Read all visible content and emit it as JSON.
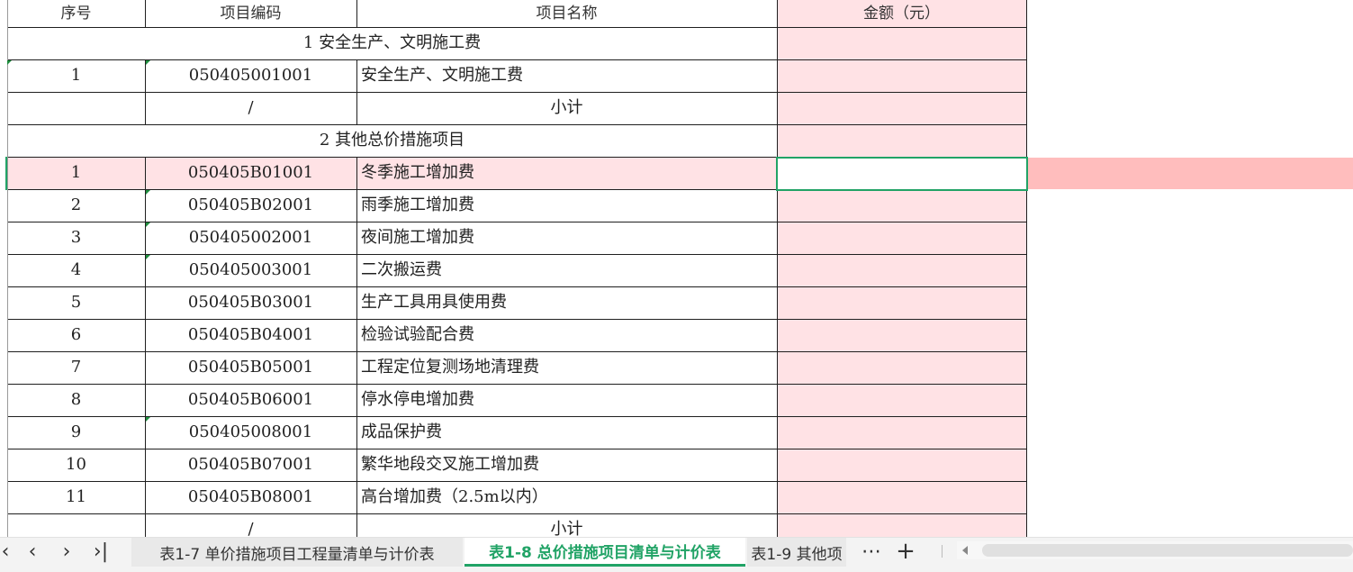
{
  "colors": {
    "amount_fill": "#ffe2e5",
    "row_highlight": "#ffe2e5",
    "row_band": "#ffbdbd",
    "selection_border": "#21a366",
    "active_tab_text": "#21a366"
  },
  "table": {
    "headers": [
      "序号",
      "项目编码",
      "项目名称",
      "金额（元）"
    ],
    "section1_title": "1 安全生产、文明施工费",
    "section1_rows": [
      {
        "no": "1",
        "code": "050405001001",
        "name": "安全生产、文明施工费"
      }
    ],
    "subtotal1": {
      "code": "/",
      "name": "小计"
    },
    "section2_title": "2 其他总价措施项目",
    "section2_rows": [
      {
        "no": "1",
        "code": "050405B01001",
        "name": "冬季施工增加费"
      },
      {
        "no": "2",
        "code": "050405B02001",
        "name": "雨季施工增加费"
      },
      {
        "no": "3",
        "code": "050405002001",
        "name": "夜间施工增加费"
      },
      {
        "no": "4",
        "code": "050405003001",
        "name": "二次搬运费"
      },
      {
        "no": "5",
        "code": "050405B03001",
        "name": "生产工具用具使用费"
      },
      {
        "no": "6",
        "code": "050405B04001",
        "name": "检验试验配合费"
      },
      {
        "no": "7",
        "code": "050405B05001",
        "name": "工程定位复测场地清理费"
      },
      {
        "no": "8",
        "code": "050405B06001",
        "name": "停水停电增加费"
      },
      {
        "no": "9",
        "code": "050405008001",
        "name": "成品保护费"
      },
      {
        "no": "10",
        "code": "050405B07001",
        "name": "繁华地段交叉施工增加费"
      },
      {
        "no": "11",
        "code": "050405B08001",
        "name": "高台增加费（2.5m以内）"
      }
    ],
    "subtotal2": {
      "code": "/",
      "name": "小计"
    }
  },
  "sheet_tabs": {
    "nav_icons": [
      "first-sheet-icon",
      "prev-sheet-icon",
      "next-sheet-icon",
      "last-sheet-icon"
    ],
    "nav_glyphs": [
      "‹",
      "‹",
      "›",
      "›|"
    ],
    "tabs": [
      {
        "label": "表1-7 单价措施项目工程量清单与计价表",
        "active": false
      },
      {
        "label": "表1-8 总价措施项目清单与计价表",
        "active": true
      },
      {
        "label": "表1-9 其他项",
        "active": false
      }
    ],
    "more_glyph": "⋯",
    "add_glyph": "+"
  }
}
